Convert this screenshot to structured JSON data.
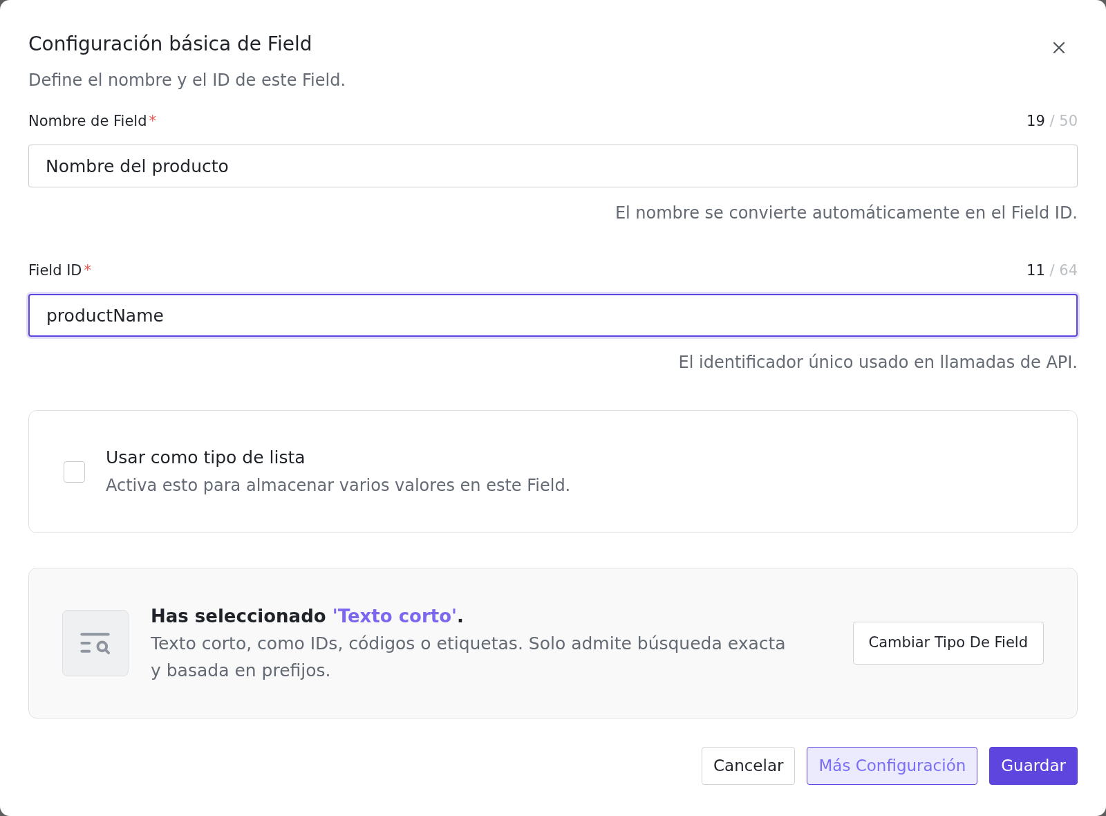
{
  "dialog": {
    "title": "Configuración básica de Field",
    "subtitle": "Define el nombre y el ID de este Field."
  },
  "fields": [
    {
      "label": "Nombre de Field",
      "required_mark": "*",
      "count": "19",
      "limit": "/ 50",
      "value": "Nombre del producto",
      "focused": false,
      "hint": "El nombre se convierte automáticamente en el Field ID."
    },
    {
      "label": "Field ID",
      "required_mark": "*",
      "count": "11",
      "limit": "/ 64",
      "value": "productName",
      "focused": true,
      "hint": "El identificador único usado en llamadas de API."
    }
  ],
  "list_option": {
    "label": "Usar como tipo de lista",
    "description": "Activa esto para almacenar varios valores en este Field.",
    "checked": false
  },
  "type_info": {
    "title_prefix": "Has seleccionado",
    "type_name": "'Texto corto'",
    "title_suffix": ".",
    "description": "Texto corto, como IDs, códigos o etiquetas. Solo admite búsqueda exacta y basada en prefijos.",
    "button": "Cambiar Tipo De Field"
  },
  "buttons": [
    {
      "label": "Cancelar",
      "kind": "default"
    },
    {
      "label": "Más Configuración",
      "kind": "secondary"
    },
    {
      "label": "Guardar",
      "kind": "primary"
    }
  ]
}
